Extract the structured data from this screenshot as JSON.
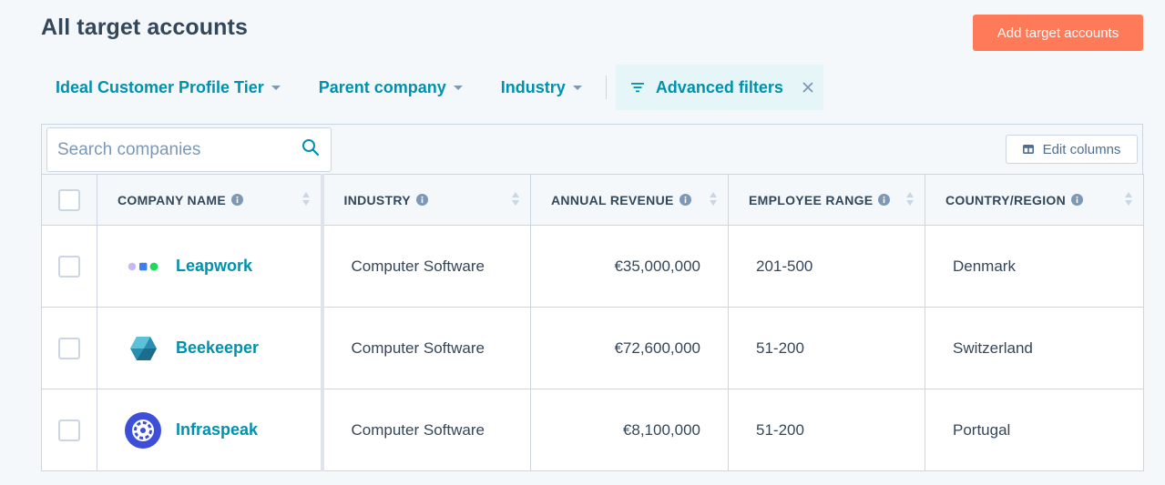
{
  "header": {
    "title": "All target accounts",
    "add_button_label": "Add target accounts"
  },
  "filters": {
    "items": [
      {
        "label": "Ideal Customer Profile Tier"
      },
      {
        "label": "Parent company"
      },
      {
        "label": "Industry"
      }
    ],
    "advanced_label": "Advanced filters"
  },
  "table": {
    "search_placeholder": "Search companies",
    "search_value": "",
    "edit_columns_label": "Edit columns",
    "columns": [
      {
        "label": "COMPANY NAME"
      },
      {
        "label": "INDUSTRY"
      },
      {
        "label": "ANNUAL REVENUE"
      },
      {
        "label": "EMPLOYEE RANGE"
      },
      {
        "label": "COUNTRY/REGION"
      }
    ],
    "rows": [
      {
        "company": "Leapwork",
        "industry": "Computer Software",
        "revenue": "€35,000,000",
        "employees": "201-500",
        "country": "Denmark",
        "logo": "leapwork-logo"
      },
      {
        "company": "Beekeeper",
        "industry": "Computer Software",
        "revenue": "€72,600,000",
        "employees": "51-200",
        "country": "Switzerland",
        "logo": "beekeeper-logo"
      },
      {
        "company": "Infraspeak",
        "industry": "Computer Software",
        "revenue": "€8,100,000",
        "employees": "51-200",
        "country": "Portugal",
        "logo": "infraspeak-logo"
      }
    ]
  },
  "colors": {
    "accent": "#0091ae",
    "primary_button": "#ff7a59",
    "text": "#33475b",
    "border": "#cbd6e2"
  }
}
